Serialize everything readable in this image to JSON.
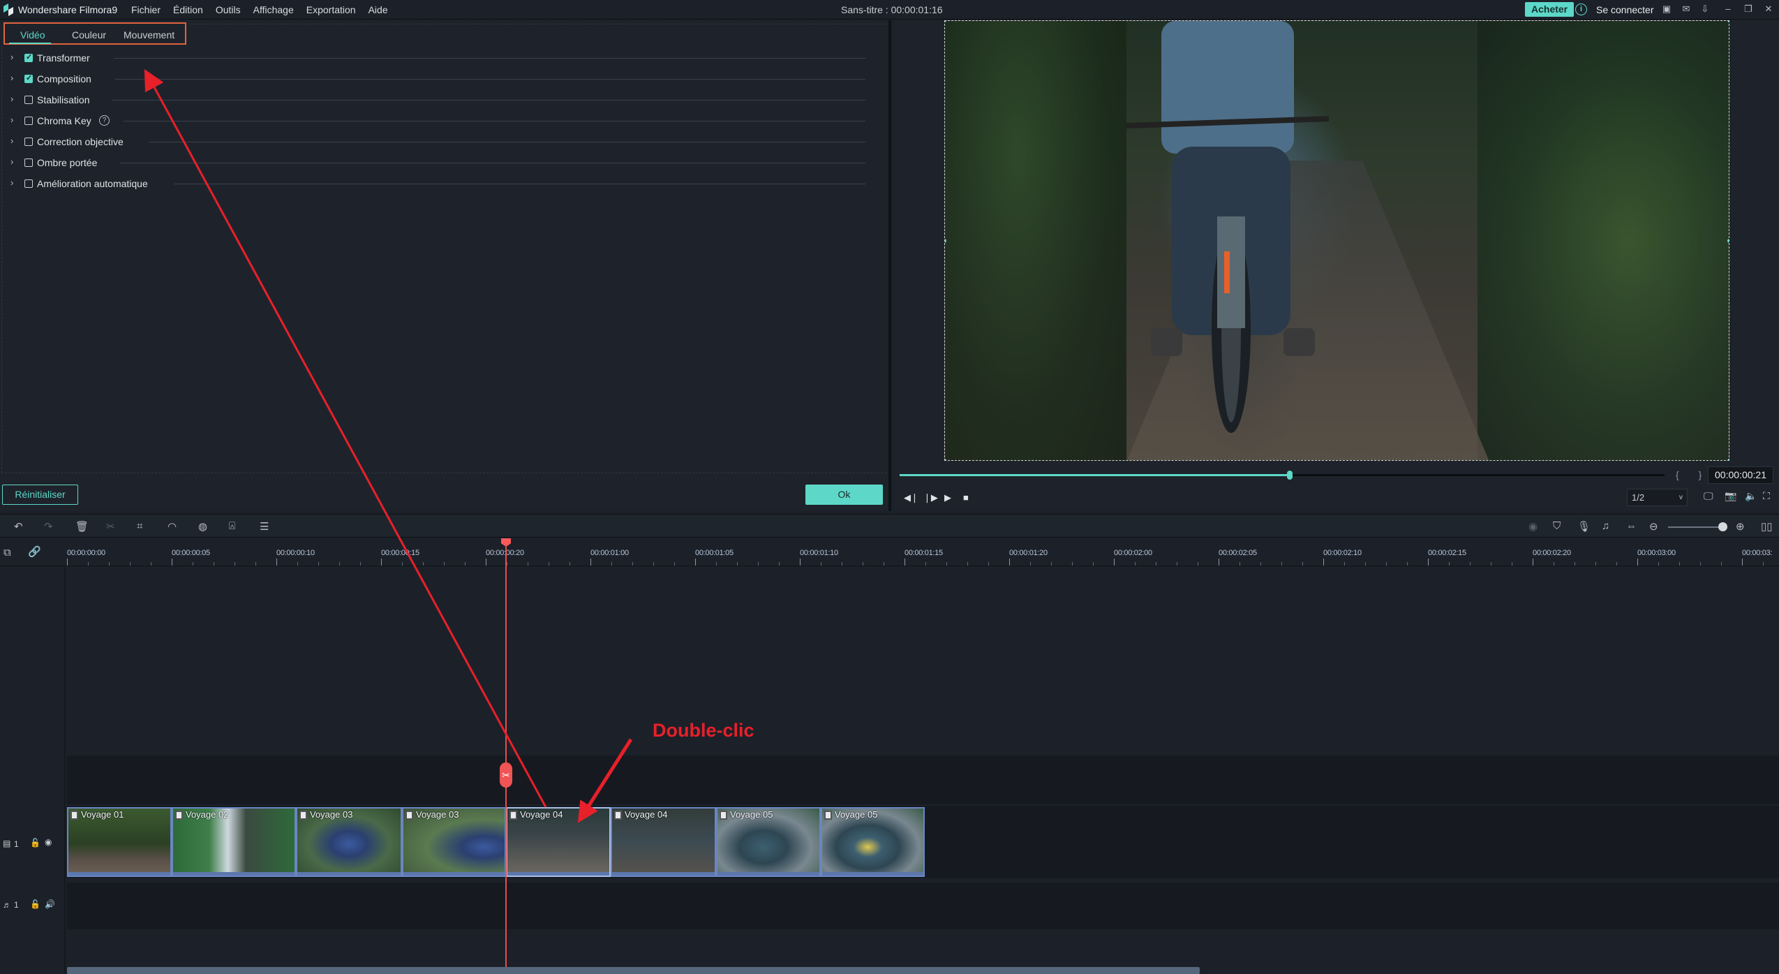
{
  "titlebar": {
    "app_name": "Wondershare Filmora9",
    "menu": [
      "Fichier",
      "Édition",
      "Outils",
      "Affichage",
      "Exportation",
      "Aide"
    ],
    "document_title": "Sans-titre : 00:00:01:16",
    "buy_label": "Acheter",
    "login_label": "Se connecter",
    "icons": [
      "save-icon",
      "mail-icon",
      "download-icon",
      "minimize-icon",
      "restore-icon",
      "close-icon"
    ]
  },
  "properties_panel": {
    "tabs": [
      {
        "label": "Vidéo",
        "active": true
      },
      {
        "label": "Couleur",
        "active": false
      },
      {
        "label": "Mouvement",
        "active": false
      }
    ],
    "rows": [
      {
        "label": "Transformer",
        "checked": true
      },
      {
        "label": "Composition",
        "checked": true
      },
      {
        "label": "Stabilisation",
        "checked": false
      },
      {
        "label": "Chroma Key",
        "checked": false,
        "help": "?"
      },
      {
        "label": "Correction objective",
        "checked": false
      },
      {
        "label": "Ombre portée",
        "checked": false
      },
      {
        "label": "Amélioration automatique",
        "checked": false
      }
    ],
    "reset_label": "Réinitialiser",
    "ok_label": "Ok"
  },
  "preview": {
    "timecode": "00:00:00:21",
    "progress_fraction": 0.51,
    "markers": "{ }",
    "quality": "1/2",
    "quality_caret": "v"
  },
  "timeline": {
    "ruler_labels": [
      "00:00:00:00",
      "00:00:00:05",
      "00:00:00:10",
      "00:00:00:15",
      "00:00:00:20",
      "00:00:01:00",
      "00:00:01:05",
      "00:00:01:10",
      "00:00:01:15",
      "00:00:01:20",
      "00:00:02:00",
      "00:00:02:05",
      "00:00:02:10",
      "00:00:02:15",
      "00:00:02:20",
      "00:00:03:00",
      "00:00:03:"
    ],
    "video_track_label": "1",
    "audio_track_label": "1",
    "clips": [
      {
        "name": "Voyage 01",
        "selected": false
      },
      {
        "name": "Voyage 02",
        "selected": false
      },
      {
        "name": "Voyage 03",
        "selected": false
      },
      {
        "name": "Voyage 03",
        "selected": false
      },
      {
        "name": "Voyage 04",
        "selected": true
      },
      {
        "name": "Voyage 04",
        "selected": false
      },
      {
        "name": "Voyage 05",
        "selected": false
      },
      {
        "name": "Voyage 05",
        "selected": false
      }
    ],
    "zoom_level_fraction": 0.95
  },
  "annotation": {
    "text": "Double-clic",
    "color": "#e8202a"
  },
  "colors": {
    "accent": "#5dd8c8",
    "playhead": "#ea4b4b",
    "tab_highlight_border": "#e0653f",
    "clip_border": "#6a86c2"
  }
}
